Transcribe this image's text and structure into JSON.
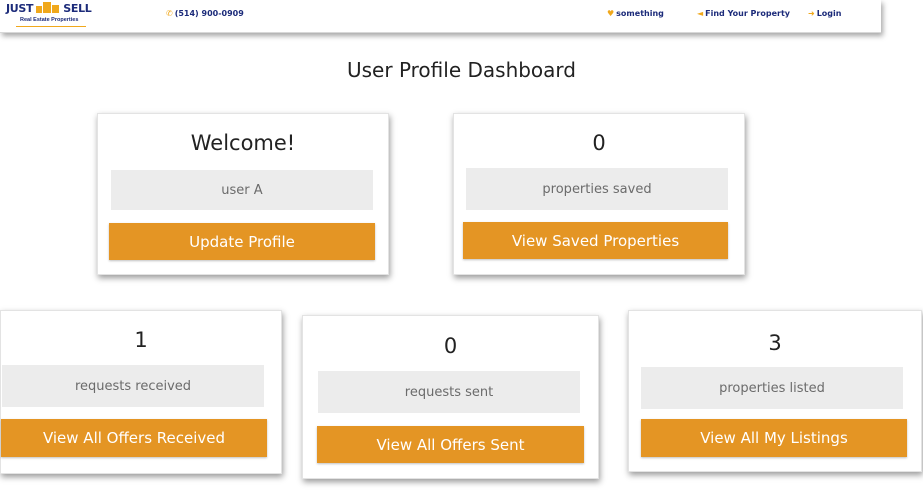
{
  "header": {
    "logo_text_left": "JUST",
    "logo_text_right": "SELL",
    "logo_subtitle": "Real Estate Properties",
    "phone": "(514) 900-0909",
    "phone_icon": "phone-icon",
    "favorites_label": "something",
    "favorites_icon": "heart-icon",
    "find_property_label": "Find Your Property",
    "find_property_icon": "megaphone-icon",
    "login_label": "Login",
    "login_icon": "login-arrow-icon"
  },
  "page": {
    "title": "User Profile Dashboard"
  },
  "cards": {
    "welcome": {
      "value": "Welcome!",
      "label": "user A",
      "button": "Update Profile"
    },
    "saved": {
      "value": "0",
      "label": "properties saved",
      "button": "View Saved Properties"
    },
    "received": {
      "value": "1",
      "label": "requests received",
      "button": "View All Offers Received"
    },
    "sent": {
      "value": "0",
      "label": "requests sent",
      "button": "View All Offers Sent"
    },
    "listed": {
      "value": "3",
      "label": "properties listed",
      "button": "View All My Listings"
    }
  },
  "colors": {
    "accent": "#e49524",
    "brand_navy": "#1c2b7a",
    "brand_gold": "#f0a81c",
    "label_bg": "#ececec"
  }
}
